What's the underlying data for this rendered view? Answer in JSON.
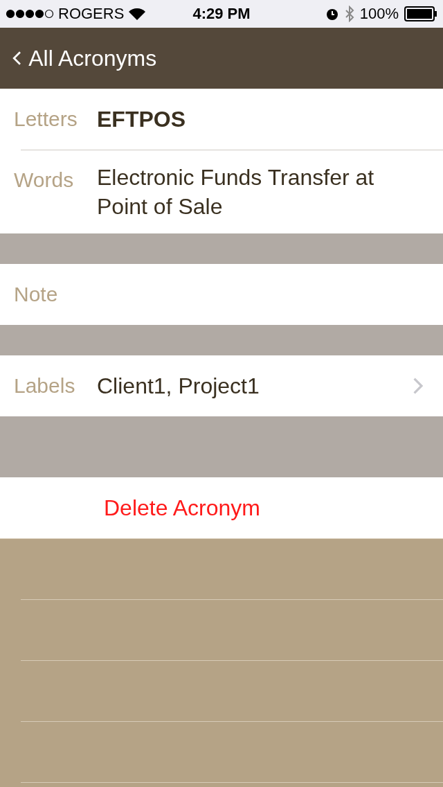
{
  "status_bar": {
    "carrier": "ROGERS",
    "time": "4:29 PM",
    "battery": "100%"
  },
  "nav": {
    "back_label": "All Acronyms"
  },
  "sections": [
    {
      "fields": [
        {
          "kind": "title",
          "label": "Letters",
          "value": "EFTPOS"
        },
        {
          "kind": "text",
          "label": "Words",
          "value": "Electronic Funds Transfer at Point of Sale"
        }
      ]
    },
    {
      "fields": [
        {
          "kind": "text",
          "label": "Note"
        }
      ]
    },
    {
      "fields": [
        {
          "kind": "link",
          "label": "Labels",
          "value": "Client1, Project1"
        }
      ]
    }
  ],
  "delete_button": "Delete Acronym"
}
